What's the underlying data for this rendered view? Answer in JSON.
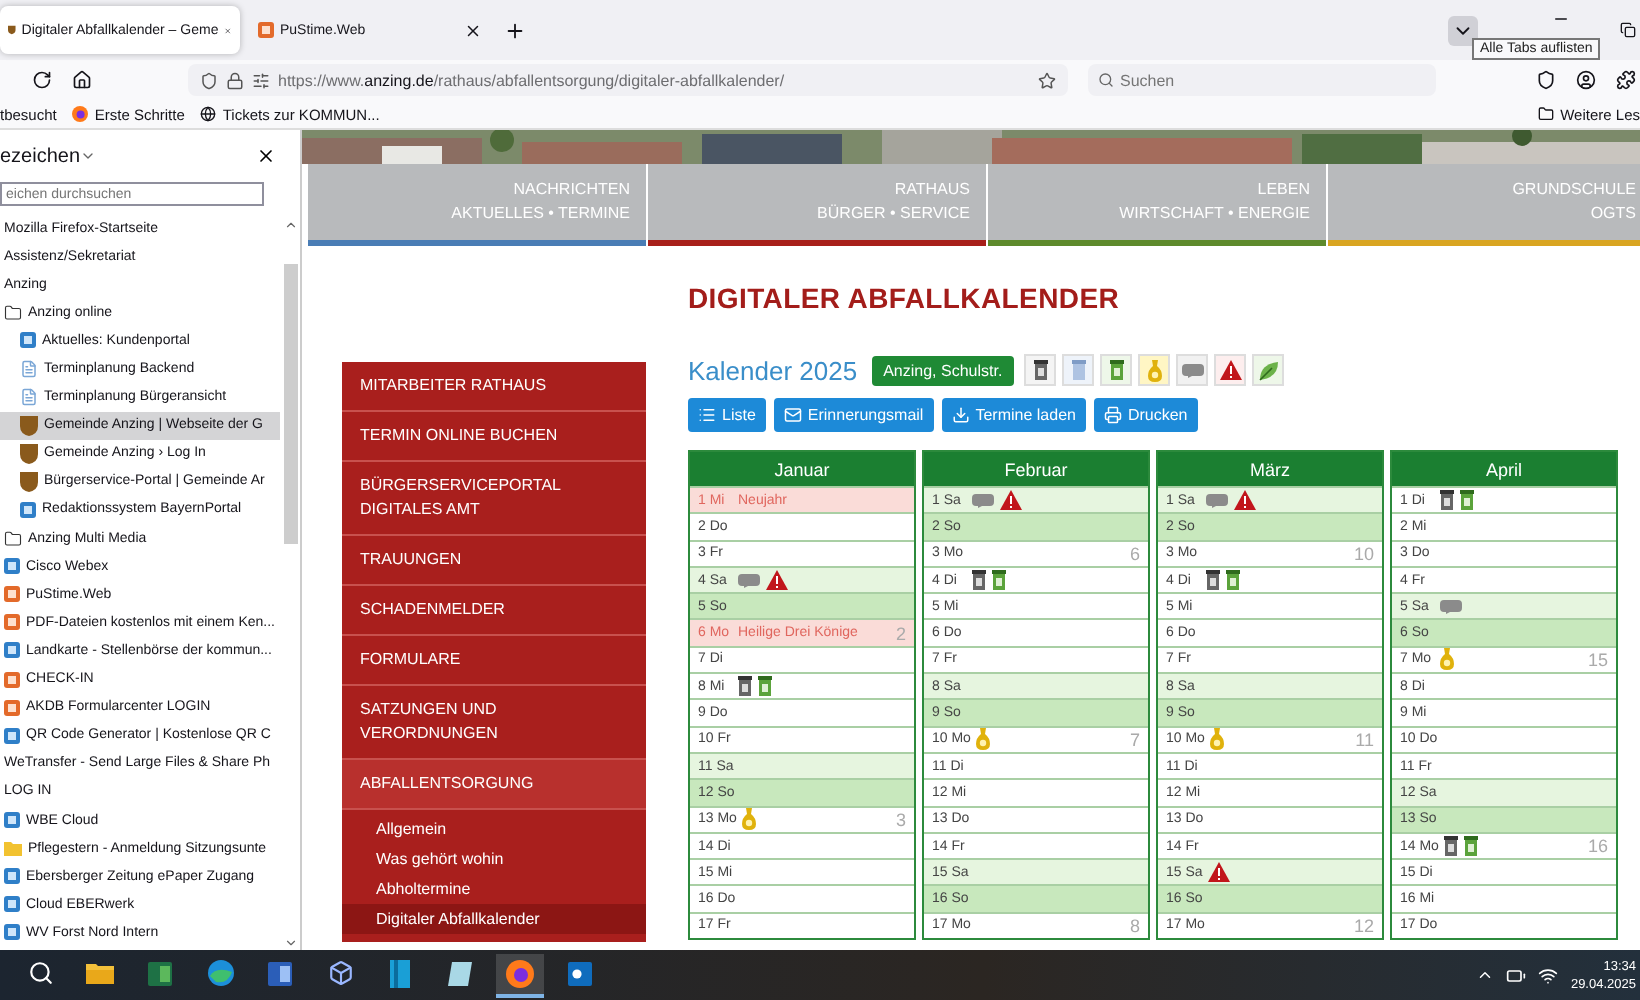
{
  "browser": {
    "tabs": [
      {
        "title": "Digitaler Abfallkalender – Geme",
        "kind": "crest",
        "selected": true
      },
      {
        "title": "PuStime.Web",
        "kind": "app",
        "selected": false
      }
    ],
    "tooltip": "Alle Tabs auflisten",
    "url": {
      "scheme": "https://www.",
      "domain": "anzing.de",
      "path": "/rathaus/abfallentsorgung/digitaler-abfallkalender/"
    },
    "search": {
      "placeholder": "Suchen"
    },
    "bookmarks": [
      {
        "label": "tbesucht",
        "kind": "text"
      },
      {
        "label": "Erste Schritte",
        "kind": "fox"
      },
      {
        "label": "Tickets zur KOMMUN...",
        "kind": "globe"
      }
    ],
    "more_bookmarks": "Weitere Les"
  },
  "sidebar": {
    "title": "ezeichen",
    "search": {
      "placeholder": "eichen durchsuchen"
    },
    "items": [
      {
        "label": "Mozilla Firefox-Startseite",
        "kind": "text",
        "selected": false
      },
      {
        "label": "Assistenz/Sekretariat",
        "kind": "text",
        "selected": false
      },
      {
        "label": "Anzing",
        "kind": "text",
        "selected": false
      },
      {
        "label": "Anzing online",
        "kind": "folder",
        "selected": false,
        "children": [
          {
            "label": "Aktuelles: Kundenportal",
            "kind": "link",
            "selected": false
          },
          {
            "label": "Terminplanung Backend",
            "kind": "page",
            "selected": false
          },
          {
            "label": "Terminplanung Bürgeransicht",
            "kind": "page",
            "selected": false
          },
          {
            "label": "Gemeinde Anzing | Webseite der G",
            "kind": "crest",
            "selected": true
          },
          {
            "label": "Gemeinde Anzing › Log In",
            "kind": "crest",
            "selected": false
          },
          {
            "label": "Bürgerservice-Portal | Gemeinde Ar",
            "kind": "crest",
            "selected": false
          },
          {
            "label": "Redaktionssystem BayernPortal",
            "kind": "link",
            "selected": false
          }
        ]
      },
      {
        "label": "Anzing Multi Media",
        "kind": "folder",
        "selected": false
      },
      {
        "label": "Cisco Webex",
        "kind": "link",
        "selected": false
      },
      {
        "label": "PuStime.Web",
        "kind": "app",
        "selected": false
      },
      {
        "label": "PDF-Dateien kostenlos mit einem Ken...",
        "kind": "app",
        "selected": false
      },
      {
        "label": "Landkarte - Stellenbörse der kommun...",
        "kind": "link",
        "selected": false
      },
      {
        "label": "CHECK-IN",
        "kind": "app",
        "selected": false
      },
      {
        "label": "AKDB Formularcenter LOGIN",
        "kind": "app",
        "selected": false
      },
      {
        "label": "QR Code Generator | Kostenlose QR C",
        "kind": "link",
        "selected": false
      },
      {
        "label": "WeTransfer - Send Large Files & Share Ph",
        "kind": "text",
        "selected": false
      },
      {
        "label": "LOG IN",
        "kind": "text",
        "selected": false
      },
      {
        "label": "WBE Cloud",
        "kind": "link",
        "selected": false
      },
      {
        "label": "Pflegestern - Anmeldung Sitzungsunte",
        "kind": "folderlink",
        "selected": false
      },
      {
        "label": "Ebersberger Zeitung ePaper Zugang",
        "kind": "link",
        "selected": false
      },
      {
        "label": "Cloud EBERwerk",
        "kind": "link",
        "selected": false
      },
      {
        "label": "WV Forst Nord Intern",
        "kind": "link",
        "selected": false
      }
    ]
  },
  "nav": [
    {
      "title": "NACHRICHTEN",
      "subtitle": "AKTUELLES • TERMINE",
      "color": "#4a7db5"
    },
    {
      "title": "RATHAUS",
      "subtitle": "BÜRGER • SERVICE",
      "color": "#a8201a"
    },
    {
      "title": "LEBEN",
      "subtitle": "WIRTSCHAFT • ENERGIE",
      "color": "#5e8a2c"
    },
    {
      "title": "GRUNDSCHULE",
      "subtitle": "OGTS",
      "color": "#d9a521"
    }
  ],
  "heading": "DIGITALER ABFALLKALENDER",
  "menu": [
    {
      "label": "MITARBEITER RATHAUS",
      "expanded": false
    },
    {
      "label": "TERMIN ONLINE BUCHEN",
      "expanded": false
    },
    {
      "label": "BÜRGERSERVICEPORTAL DIGITALES AMT",
      "expanded": false
    },
    {
      "label": "TRAUUNGEN",
      "expanded": false
    },
    {
      "label": "SCHADENMELDER",
      "expanded": false
    },
    {
      "label": "FORMULARE",
      "expanded": false
    },
    {
      "label": "SATZUNGEN UND VERORDNUNGEN",
      "expanded": false
    },
    {
      "label": "ABFALLENTSORGUNG",
      "expanded": true,
      "children": [
        {
          "label": "Allgemein",
          "selected": false
        },
        {
          "label": "Was gehört wohin",
          "selected": false
        },
        {
          "label": "Abholtermine",
          "selected": false
        },
        {
          "label": "Digitaler Abfallkalender",
          "selected": true
        }
      ]
    }
  ],
  "calendar": {
    "title": "Kalender 2025",
    "location": "Anzing, Schulstr.",
    "filters": [
      {
        "kind": "rest"
      },
      {
        "kind": "paper"
      },
      {
        "kind": "bio"
      },
      {
        "kind": "yellow"
      },
      {
        "kind": "bulky"
      },
      {
        "kind": "warning"
      },
      {
        "kind": "green"
      }
    ],
    "buttons": [
      {
        "label": "Liste",
        "kind": "list"
      },
      {
        "label": "Erinnerungsmail",
        "kind": "mail"
      },
      {
        "label": "Termine laden",
        "kind": "download"
      },
      {
        "label": "Drucken",
        "kind": "print"
      }
    ],
    "months": [
      {
        "name": "Januar",
        "days": [
          {
            "day": "1 Mi",
            "kind": "holiday",
            "holiday": "Neujahr"
          },
          {
            "day": "2 Do",
            "kind": "weekday"
          },
          {
            "day": "3 Fr",
            "kind": "weekday"
          },
          {
            "day": "4 Sa",
            "kind": "saturday",
            "pickups": [
              {
                "kind": "bulky"
              },
              {
                "kind": "warning"
              }
            ]
          },
          {
            "day": "5 So",
            "kind": "sunday"
          },
          {
            "day": "6 Mo",
            "kind": "holiday",
            "holiday": "Heilige Drei Könige",
            "week": "2"
          },
          {
            "day": "7 Di",
            "kind": "weekday"
          },
          {
            "day": "8 Mi",
            "kind": "weekday",
            "pickups": [
              {
                "kind": "rest"
              },
              {
                "kind": "bio"
              }
            ]
          },
          {
            "day": "9 Do",
            "kind": "weekday"
          },
          {
            "day": "10 Fr",
            "kind": "weekday"
          },
          {
            "day": "11 Sa",
            "kind": "saturday"
          },
          {
            "day": "12 So",
            "kind": "sunday"
          },
          {
            "day": "13 Mo",
            "kind": "weekday",
            "pickups": [
              {
                "kind": "yellow"
              }
            ],
            "week": "3"
          },
          {
            "day": "14 Di",
            "kind": "weekday"
          },
          {
            "day": "15 Mi",
            "kind": "weekday"
          },
          {
            "day": "16 Do",
            "kind": "weekday"
          },
          {
            "day": "17 Fr",
            "kind": "weekday"
          }
        ]
      },
      {
        "name": "Februar",
        "days": [
          {
            "day": "1 Sa",
            "kind": "saturday",
            "pickups": [
              {
                "kind": "bulky"
              },
              {
                "kind": "warning"
              }
            ]
          },
          {
            "day": "2 So",
            "kind": "sunday"
          },
          {
            "day": "3 Mo",
            "kind": "weekday",
            "week": "6"
          },
          {
            "day": "4 Di",
            "kind": "weekday",
            "pickups": [
              {
                "kind": "rest"
              },
              {
                "kind": "bio"
              }
            ]
          },
          {
            "day": "5 Mi",
            "kind": "weekday"
          },
          {
            "day": "6 Do",
            "kind": "weekday"
          },
          {
            "day": "7 Fr",
            "kind": "weekday"
          },
          {
            "day": "8 Sa",
            "kind": "saturday"
          },
          {
            "day": "9 So",
            "kind": "sunday"
          },
          {
            "day": "10 Mo",
            "kind": "weekday",
            "pickups": [
              {
                "kind": "yellow"
              }
            ],
            "week": "7"
          },
          {
            "day": "11 Di",
            "kind": "weekday"
          },
          {
            "day": "12 Mi",
            "kind": "weekday"
          },
          {
            "day": "13 Do",
            "kind": "weekday"
          },
          {
            "day": "14 Fr",
            "kind": "weekday"
          },
          {
            "day": "15 Sa",
            "kind": "saturday"
          },
          {
            "day": "16 So",
            "kind": "sunday"
          },
          {
            "day": "17 Mo",
            "kind": "weekday",
            "week": "8"
          }
        ]
      },
      {
        "name": "März",
        "days": [
          {
            "day": "1 Sa",
            "kind": "saturday",
            "pickups": [
              {
                "kind": "bulky"
              },
              {
                "kind": "warning"
              }
            ]
          },
          {
            "day": "2 So",
            "kind": "sunday"
          },
          {
            "day": "3 Mo",
            "kind": "weekday",
            "week": "10"
          },
          {
            "day": "4 Di",
            "kind": "weekday",
            "pickups": [
              {
                "kind": "rest"
              },
              {
                "kind": "bio"
              }
            ]
          },
          {
            "day": "5 Mi",
            "kind": "weekday"
          },
          {
            "day": "6 Do",
            "kind": "weekday"
          },
          {
            "day": "7 Fr",
            "kind": "weekday"
          },
          {
            "day": "8 Sa",
            "kind": "saturday"
          },
          {
            "day": "9 So",
            "kind": "sunday"
          },
          {
            "day": "10 Mo",
            "kind": "weekday",
            "pickups": [
              {
                "kind": "yellow"
              }
            ],
            "week": "11"
          },
          {
            "day": "11 Di",
            "kind": "weekday"
          },
          {
            "day": "12 Mi",
            "kind": "weekday"
          },
          {
            "day": "13 Do",
            "kind": "weekday"
          },
          {
            "day": "14 Fr",
            "kind": "weekday"
          },
          {
            "day": "15 Sa",
            "kind": "saturday",
            "pickups": [
              {
                "kind": "warning"
              }
            ]
          },
          {
            "day": "16 So",
            "kind": "sunday"
          },
          {
            "day": "17 Mo",
            "kind": "weekday",
            "week": "12"
          }
        ]
      },
      {
        "name": "April",
        "days": [
          {
            "day": "1 Di",
            "kind": "weekday",
            "pickups": [
              {
                "kind": "rest"
              },
              {
                "kind": "bio"
              }
            ]
          },
          {
            "day": "2 Mi",
            "kind": "weekday"
          },
          {
            "day": "3 Do",
            "kind": "weekday"
          },
          {
            "day": "4 Fr",
            "kind": "weekday"
          },
          {
            "day": "5 Sa",
            "kind": "saturday",
            "pickups": [
              {
                "kind": "bulky"
              }
            ]
          },
          {
            "day": "6 So",
            "kind": "sunday"
          },
          {
            "day": "7 Mo",
            "kind": "weekday",
            "pickups": [
              {
                "kind": "yellow"
              }
            ],
            "week": "15"
          },
          {
            "day": "8 Di",
            "kind": "weekday"
          },
          {
            "day": "9 Mi",
            "kind": "weekday"
          },
          {
            "day": "10 Do",
            "kind": "weekday"
          },
          {
            "day": "11 Fr",
            "kind": "weekday"
          },
          {
            "day": "12 Sa",
            "kind": "saturday"
          },
          {
            "day": "13 So",
            "kind": "sunday"
          },
          {
            "day": "14 Mo",
            "kind": "weekday",
            "pickups": [
              {
                "kind": "rest"
              },
              {
                "kind": "bio"
              }
            ],
            "week": "16"
          },
          {
            "day": "15 Di",
            "kind": "weekday"
          },
          {
            "day": "16 Mi",
            "kind": "weekday"
          },
          {
            "day": "17 Do",
            "kind": "weekday"
          }
        ]
      }
    ]
  },
  "taskbar": {
    "apps": [
      {
        "kind": "search",
        "selected": false
      },
      {
        "kind": "explorer",
        "selected": false
      },
      {
        "kind": "excel",
        "selected": false
      },
      {
        "kind": "edge",
        "selected": false
      },
      {
        "kind": "word",
        "selected": false
      },
      {
        "kind": "cube",
        "selected": false
      },
      {
        "kind": "panel",
        "selected": false
      },
      {
        "kind": "notes",
        "selected": false
      },
      {
        "kind": "firefox",
        "selected": true
      },
      {
        "kind": "outlook",
        "selected": false
      }
    ],
    "time": "13:34",
    "date": "29.04.2025"
  }
}
